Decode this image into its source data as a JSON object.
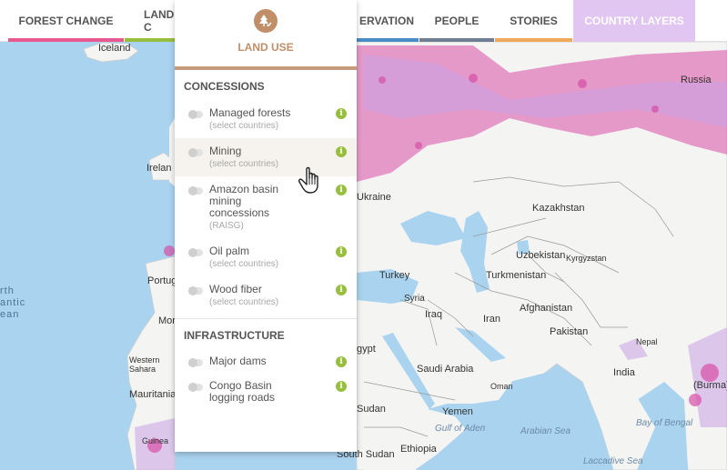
{
  "nav": {
    "tabs": [
      {
        "label": "FOREST CHANGE",
        "color": "#e9578f"
      },
      {
        "label": "LAND COVER",
        "color": "#97be3d"
      },
      {
        "label": "LAND USE",
        "color": "#c08f6a"
      },
      {
        "label": "CONSERVATION",
        "color": "#4a8cc6"
      },
      {
        "label": "PEOPLE",
        "color": "#707d92"
      },
      {
        "label": "STORIES",
        "color": "#f0a85a"
      },
      {
        "label": "COUNTRY LAYERS",
        "color": "#e2c6f2"
      }
    ],
    "visible": {
      "forest_change": "FOREST CHANGE",
      "land_cover_partial": "LAND C",
      "conservation_partial": "ERVATION",
      "people": "PEOPLE",
      "stories": "STORIES",
      "country_layers": "COUNTRY LAYERS"
    }
  },
  "dropdown": {
    "title": "LAND USE",
    "icon": "land-use-tree-icon",
    "accent": "#c08f6a",
    "sections": [
      {
        "title": "CONCESSIONS",
        "layers": [
          {
            "name": "Managed forests",
            "sub": "(select countries)"
          },
          {
            "name": "Mining",
            "sub": "(select countries)"
          },
          {
            "name": "Amazon basin mining concessions",
            "sub": "(RAISG)"
          },
          {
            "name": "Oil palm",
            "sub": "(select countries)"
          },
          {
            "name": "Wood fiber",
            "sub": "(select countries)"
          }
        ]
      },
      {
        "title": "INFRASTRUCTURE",
        "layers": [
          {
            "name": "Major dams",
            "sub": ""
          },
          {
            "name": "Congo Basin logging roads",
            "sub": ""
          }
        ]
      }
    ],
    "info_glyph": "i"
  },
  "map": {
    "labels": {
      "iceland": "Iceland",
      "ireland": "Irelan",
      "portugal": "Portug",
      "morocco": "Mor",
      "western_sahara": "Western Sahara",
      "mauritania": "Mauritania",
      "guinea": "Guinea",
      "north_atlantic_1": "rth",
      "north_atlantic_2": "antic",
      "north_atlantic_3": "ean",
      "russia": "Russia",
      "ukraine": "Ukraine",
      "kazakhstan": "Kazakhstan",
      "uzbekistan": "Uzbekistan",
      "kyrgyzstan": "Kyrgyzstan",
      "turkmenistan": "Turkmenistan",
      "turkey": "Turkey",
      "syria": "Syria",
      "iraq": "Iraq",
      "iran": "Iran",
      "afghanistan": "Afghanistan",
      "pakistan": "Pakistan",
      "nepal": "Nepal",
      "india": "India",
      "burma": "(Burma)",
      "egypt": "gypt",
      "saudi_arabia": "Saudi Arabia",
      "oman": "Oman",
      "yemen": "Yemen",
      "sudan": "Sudan",
      "south_sudan": "South Sudan",
      "ethiopia": "Ethiopia",
      "gulf_of_aden": "Gulf of Aden",
      "arabian_sea": "Arabian Sea",
      "bay_of_bengal": "Bay of Bengal",
      "laccadive_sea": "Laccadive Sea"
    },
    "colors": {
      "water": "#a9d3ef",
      "land": "#f4f4f2",
      "forest_loss": "#d84ea8",
      "forest_gain": "#c9a3e6"
    }
  }
}
